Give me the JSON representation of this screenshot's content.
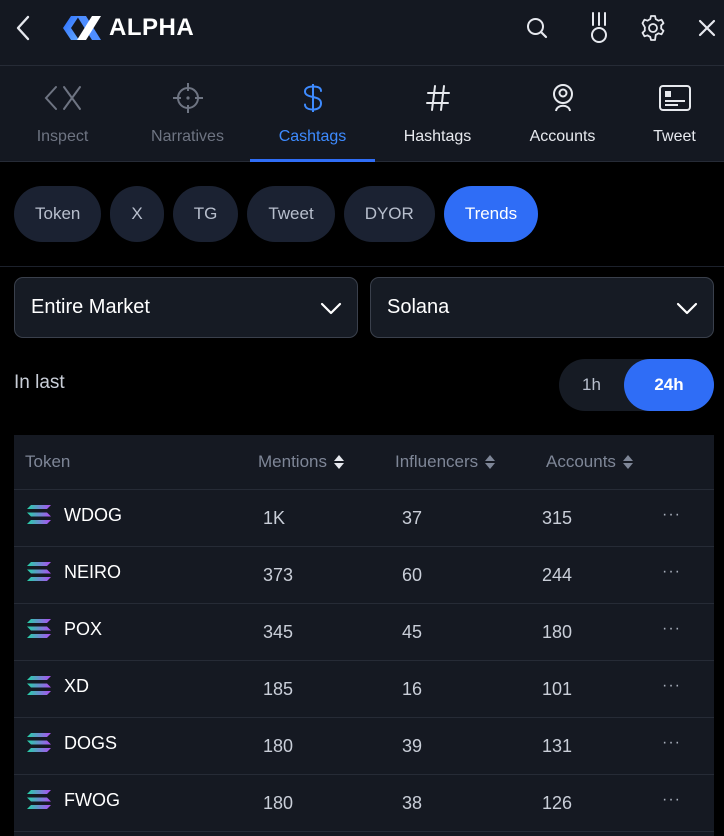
{
  "app": {
    "name": "ALPHA"
  },
  "header": {
    "back_icon": "chevron-left-icon",
    "search_icon": "search-icon",
    "medal_icon": "medal-icon",
    "settings_icon": "gear-icon",
    "close_icon": "close-icon"
  },
  "tabs": [
    {
      "label": "Inspect",
      "icon": "inspect-icon",
      "state": "dim"
    },
    {
      "label": "Narratives",
      "icon": "crosshair-icon",
      "state": "dim"
    },
    {
      "label": "Cashtags",
      "icon": "dollar-icon",
      "state": "active"
    },
    {
      "label": "Hashtags",
      "icon": "hash-icon",
      "state": "normal"
    },
    {
      "label": "Accounts",
      "icon": "account-icon",
      "state": "normal"
    },
    {
      "label": "Tweet",
      "icon": "tweet-card-icon",
      "state": "normal"
    }
  ],
  "chips": [
    {
      "label": "Token",
      "active": false
    },
    {
      "label": "X",
      "active": false
    },
    {
      "label": "TG",
      "active": false
    },
    {
      "label": "Tweet",
      "active": false
    },
    {
      "label": "DYOR",
      "active": false
    },
    {
      "label": "Trends",
      "active": true
    }
  ],
  "filters": {
    "market": "Entire Market",
    "chain": "Solana"
  },
  "time": {
    "label": "In last",
    "options": [
      "1h",
      "24h"
    ],
    "selected": "24h"
  },
  "table": {
    "columns": [
      "Token",
      "Mentions",
      "Influencers",
      "Accounts"
    ],
    "rows": [
      {
        "token": "WDOG",
        "mentions": "1K",
        "influencers": "37",
        "accounts": "315"
      },
      {
        "token": "NEIRO",
        "mentions": "373",
        "influencers": "60",
        "accounts": "244"
      },
      {
        "token": "POX",
        "mentions": "345",
        "influencers": "45",
        "accounts": "180"
      },
      {
        "token": "XD",
        "mentions": "185",
        "influencers": "16",
        "accounts": "101"
      },
      {
        "token": "DOGS",
        "mentions": "180",
        "influencers": "39",
        "accounts": "131"
      },
      {
        "token": "FWOG",
        "mentions": "180",
        "influencers": "38",
        "accounts": "126"
      }
    ],
    "more_label": "···"
  },
  "colors": {
    "accent": "#2f6df6",
    "active_tab_text": "#3e8bff",
    "chip_bg": "#1b2232",
    "panel_bg": "#141821"
  }
}
